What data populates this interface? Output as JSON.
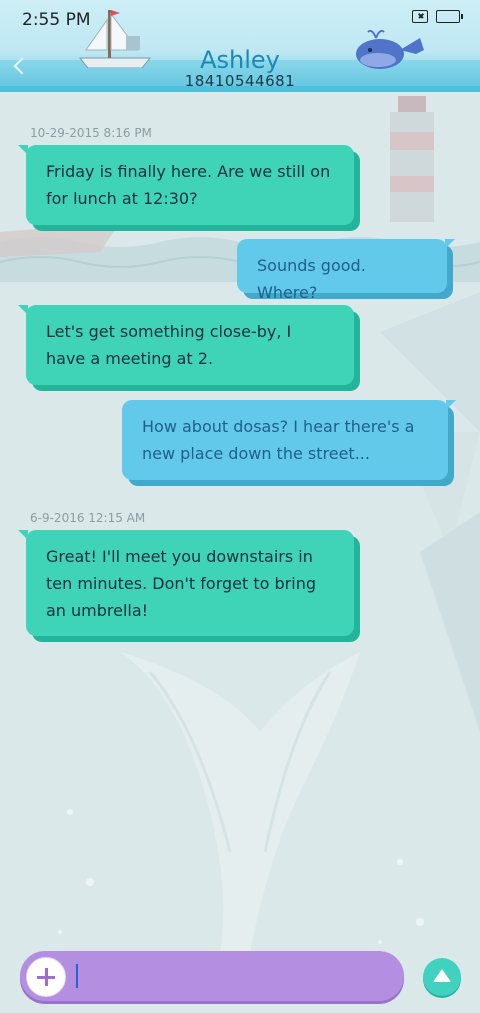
{
  "status_bar": {
    "time": "2:55 PM"
  },
  "header": {
    "contact_name": "Ashley",
    "contact_number": "18410544681"
  },
  "messages": [
    {
      "timestamp": "10-29-2015 8:16 PM"
    },
    {
      "direction": "incoming",
      "text": "Friday is finally here. Are we still on for lunch at 12:30?"
    },
    {
      "direction": "outgoing",
      "text": "Sounds good. Where?"
    },
    {
      "direction": "incoming",
      "text": "Let's get something close-by, I have a meeting at 2."
    },
    {
      "direction": "outgoing",
      "text": "How about dosas? I hear there's a new place down the street..."
    },
    {
      "timestamp": "6-9-2016 12:15 AM"
    },
    {
      "direction": "incoming",
      "text": "Great! I'll meet you downstairs in ten minutes. Don't forget to bring an umbrella!"
    }
  ],
  "composer": {
    "input_value": "",
    "placeholder": ""
  },
  "colors": {
    "incoming_bubble": "#3fd3b8",
    "outgoing_bubble": "#63c9ea",
    "composer": "#b48ee0",
    "send_button": "#40d2bf"
  },
  "icons": {
    "back": "back-icon",
    "sim": "sim-card-icon",
    "battery": "battery-icon",
    "add": "plus-icon",
    "send": "send-arrow-icon"
  }
}
